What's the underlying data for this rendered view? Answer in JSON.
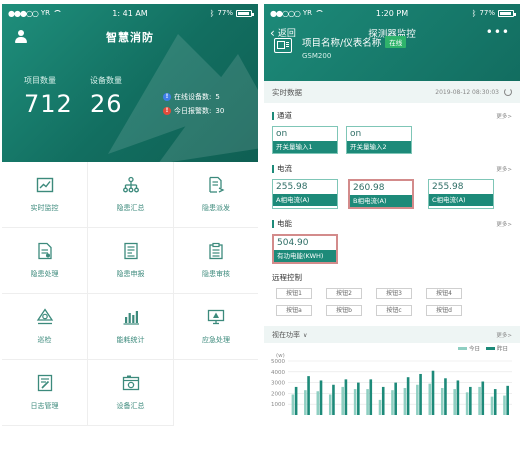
{
  "left": {
    "status": {
      "carrier": "YR",
      "time": "1: 41 AM",
      "battery": "77%"
    },
    "title": "智慧消防",
    "stats": [
      {
        "label": "项目数量",
        "value": "712"
      },
      {
        "label": "设备数量",
        "value": "26"
      }
    ],
    "side_stats": [
      {
        "icon": "info-icon",
        "badge": "!",
        "label": "在线设备数:",
        "value": "5",
        "color": "#3f7ee8"
      },
      {
        "icon": "alert-icon",
        "badge": "!",
        "label": "今日报警数:",
        "value": "30",
        "color": "#e24b3b"
      }
    ],
    "menu": [
      {
        "label": "实时监控",
        "icon": "trend-chart-icon"
      },
      {
        "label": "隐患汇总",
        "icon": "hierarchy-icon"
      },
      {
        "label": "隐患派发",
        "icon": "dispatch-doc-icon"
      },
      {
        "label": "隐患处理",
        "icon": "process-doc-icon"
      },
      {
        "label": "隐患申报",
        "icon": "report-doc-icon"
      },
      {
        "label": "隐患审核",
        "icon": "clipboard-icon"
      },
      {
        "label": "巡检",
        "icon": "patrol-icon"
      },
      {
        "label": "能耗统计",
        "icon": "bar-stats-icon"
      },
      {
        "label": "应急处理",
        "icon": "monitor-icon"
      },
      {
        "label": "日志管理",
        "icon": "edit-log-icon"
      },
      {
        "label": "设备汇总",
        "icon": "device-camera-icon"
      }
    ]
  },
  "right": {
    "status": {
      "carrier": "YR",
      "time": "1:20 PM",
      "battery": "77%"
    },
    "nav": {
      "back_label": "返回",
      "title": "探测器监控",
      "more": "•••"
    },
    "device": {
      "name": "项目名称/仪表名称",
      "status": "在线",
      "model": "GSM200"
    },
    "realtime": {
      "label": "实时数据",
      "timestamp": "2019-08-12 08:30:03"
    },
    "sections": [
      {
        "title": "通道",
        "more": "更多>",
        "cards": [
          {
            "value": "on",
            "label": "开关量输入1",
            "selected": false
          },
          {
            "value": "on",
            "label": "开关量输入2",
            "selected": false
          }
        ]
      },
      {
        "title": "电流",
        "more": "更多>",
        "cards": [
          {
            "value": "255.98",
            "label": "A相电流(A)",
            "selected": false
          },
          {
            "value": "260.98",
            "label": "B相电流(A)",
            "selected": true
          },
          {
            "value": "255.98",
            "label": "C相电流(A)",
            "selected": false
          }
        ]
      },
      {
        "title": "电能",
        "more": "更多>",
        "cards": [
          {
            "value": "504.90",
            "label": "有功电能(KWH)",
            "selected": true
          }
        ]
      }
    ],
    "remote": {
      "title": "远程控制",
      "rows": [
        [
          "按钮1",
          "按钮2",
          "按钮3",
          "按钮4"
        ],
        [
          "按钮a",
          "按钮b",
          "按钮c",
          "按钮d"
        ]
      ]
    },
    "chart_header": {
      "label": "视在功率",
      "more": "更多>"
    }
  },
  "chart_data": {
    "type": "bar",
    "title": "",
    "ylabel": "(w)",
    "ylim": [
      0,
      5000
    ],
    "yticks": [
      1000,
      2000,
      3000,
      4000,
      5000
    ],
    "legend_position": "top-right",
    "series": [
      {
        "name": "今日",
        "color": "#8fcfc2",
        "values": [
          1900,
          2300,
          2200,
          1900,
          2600,
          2400,
          2400,
          1400,
          2300,
          2500,
          2800,
          2900,
          2500,
          2400,
          2100,
          2600,
          1700,
          1800
        ]
      },
      {
        "name": "昨日",
        "color": "#1d8a79",
        "values": [
          2600,
          3600,
          3200,
          2800,
          3300,
          3000,
          3300,
          2600,
          3000,
          3500,
          3800,
          4100,
          3400,
          3200,
          2600,
          3100,
          2400,
          2700
        ]
      }
    ],
    "colors": {
      "today": "#8fcfc2",
      "yesterday": "#1d8a79",
      "grid": "#e3e3e3"
    }
  }
}
